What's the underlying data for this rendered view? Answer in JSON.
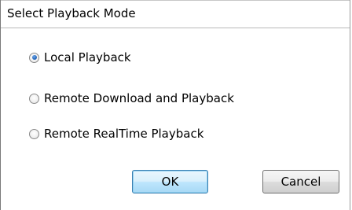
{
  "dialog": {
    "title": "Select Playback Mode"
  },
  "playback_modes": [
    {
      "label": "Local Playback",
      "selected": true
    },
    {
      "label": "Remote Download and Playback",
      "selected": false
    },
    {
      "label": "Remote RealTime Playback",
      "selected": false
    }
  ],
  "buttons": {
    "ok_label": "OK",
    "cancel_label": "Cancel"
  }
}
